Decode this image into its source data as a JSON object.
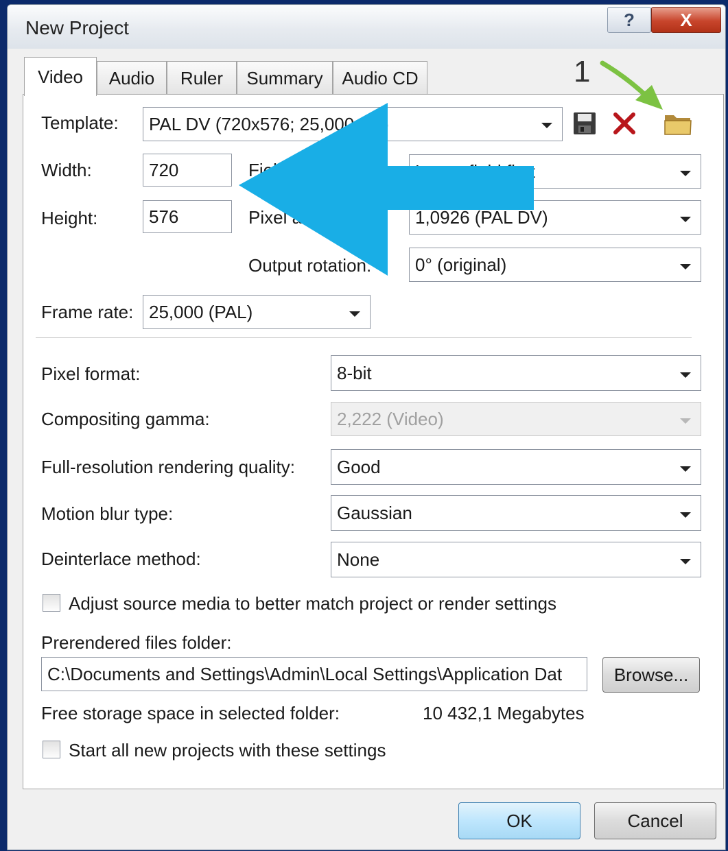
{
  "window": {
    "title": "New Project",
    "help_glyph": "?",
    "close_glyph": "X"
  },
  "tabs": [
    {
      "label": "Video",
      "active": true
    },
    {
      "label": "Audio",
      "active": false
    },
    {
      "label": "Ruler",
      "active": false
    },
    {
      "label": "Summary",
      "active": false
    },
    {
      "label": "Audio CD",
      "active": false
    }
  ],
  "video": {
    "template_label": "Template:",
    "template_value": "PAL DV (720x576; 25,000 fps)",
    "width_label": "Width:",
    "width_value": "720",
    "height_label": "Height:",
    "height_value": "576",
    "field_order_label": "Field order:",
    "field_order_value": "Lower field first",
    "pixel_aspect_label": "Pixel aspect ratio:",
    "pixel_aspect_value": "1,0926 (PAL DV)",
    "output_rotation_label": "Output rotation:",
    "output_rotation_value": "0° (original)",
    "frame_rate_label": "Frame rate:",
    "frame_rate_value": "25,000 (PAL)",
    "pixel_format_label": "Pixel format:",
    "pixel_format_value": "8-bit",
    "compositing_gamma_label": "Compositing gamma:",
    "compositing_gamma_value": "2,222 (Video)",
    "rendering_quality_label": "Full-resolution rendering quality:",
    "rendering_quality_value": "Good",
    "motion_blur_label": "Motion blur type:",
    "motion_blur_value": "Gaussian",
    "deinterlace_label": "Deinterlace method:",
    "deinterlace_value": "None",
    "adjust_source_label": "Adjust source media to better match project or render settings",
    "adjust_source_checked": false,
    "prerendered_label": "Prerendered files folder:",
    "prerendered_path": "C:\\Documents and Settings\\Admin\\Local Settings\\Application Dat",
    "browse_label": "Browse...",
    "free_space_label": "Free storage space in selected folder:",
    "free_space_value": "10 432,1 Megabytes",
    "start_all_label": "Start all new projects with these settings",
    "start_all_checked": false
  },
  "buttons": {
    "ok_label": "OK",
    "cancel_label": "Cancel"
  },
  "annotation": {
    "number": "1",
    "green_arrow_color": "#7cc242",
    "blue_arrow_color": "#19aee6"
  },
  "icons": [
    "help-icon",
    "close-icon",
    "save-icon",
    "delete-icon",
    "open-folder-icon",
    "dropdown-arrow-icon"
  ]
}
